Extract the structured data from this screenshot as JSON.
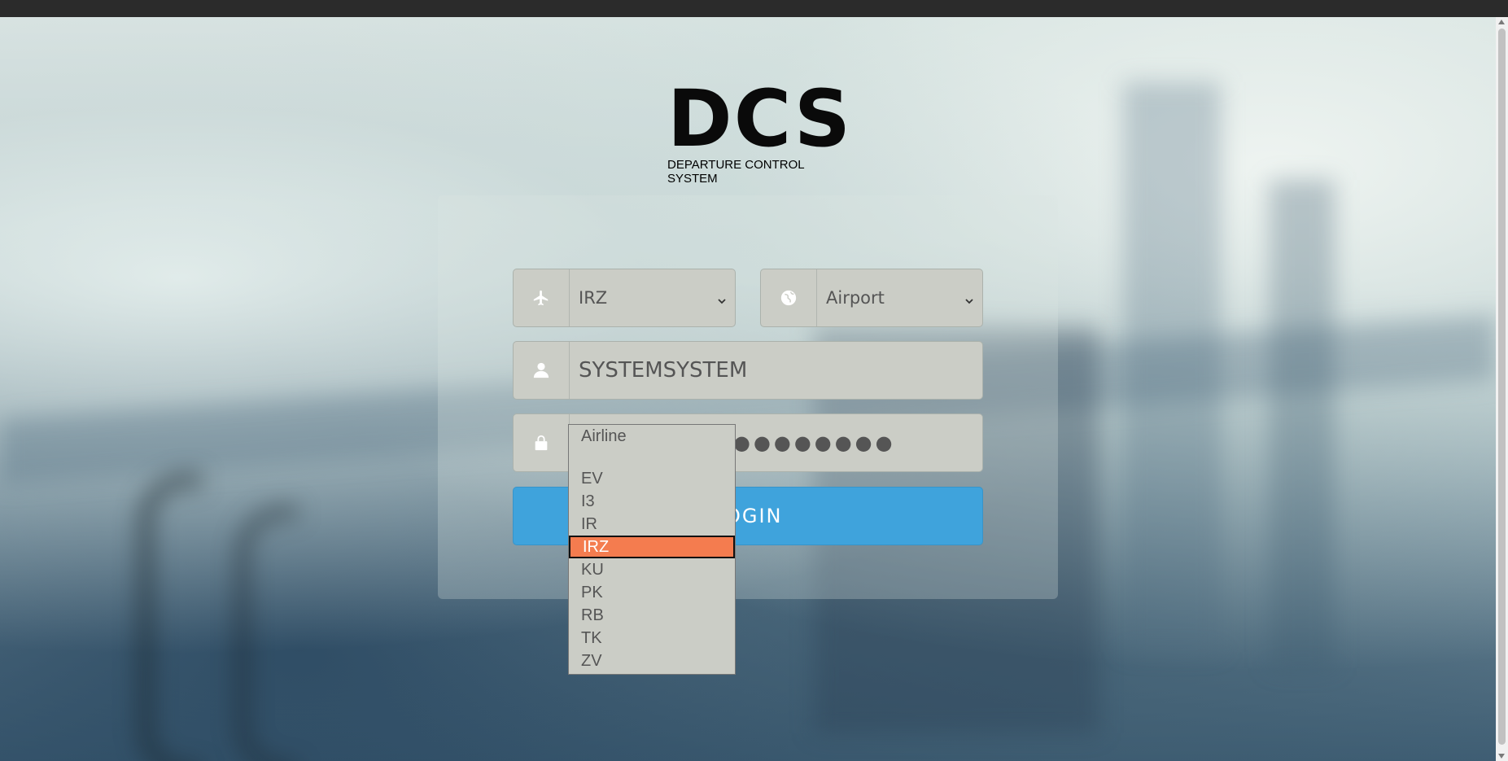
{
  "logo": {
    "title": "DCS",
    "subtitle": "DEPARTURE CONTROL SYSTEM"
  },
  "form": {
    "airline_select": {
      "value": "IRZ",
      "icon": "airplane-icon"
    },
    "airport_select": {
      "value": "Airport",
      "icon": "globe-icon"
    },
    "username": {
      "value": "SYSTEMSYSTEM",
      "icon": "user-icon"
    },
    "password": {
      "value": "●●●●●●●●",
      "icon": "lock-icon"
    },
    "login_label": "LOGIN"
  },
  "airline_dropdown": {
    "placeholder": "Airline",
    "options": [
      "",
      "EV",
      "I3",
      "IR",
      "IRZ",
      "KU",
      "PK",
      "RB",
      "TK",
      "ZV"
    ],
    "selected": "IRZ"
  },
  "colors": {
    "login_button": "#3fa3dc",
    "selected_option": "#f47c4f",
    "field_bg": "#cbcdc6"
  }
}
